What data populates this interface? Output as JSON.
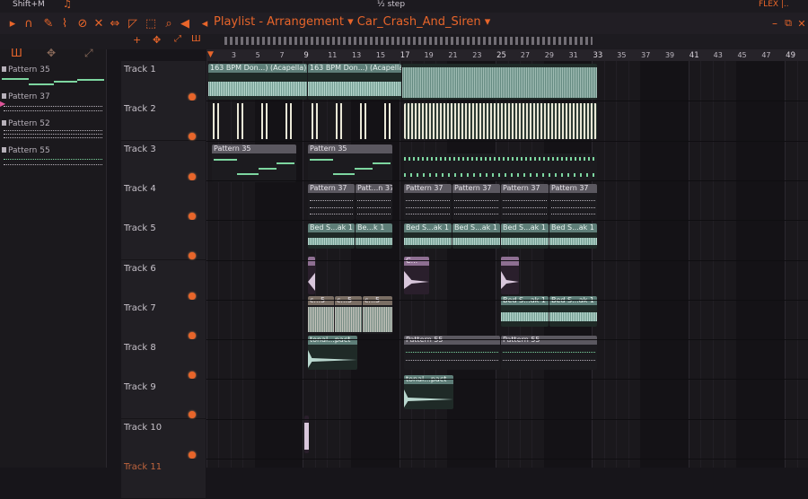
{
  "app": {
    "title": "Playlist - Arrangement",
    "project": "Car_Crash_And_Siren",
    "mode_label": "Shift+M",
    "flex_label": "FLEX |..",
    "step_label": "½ step"
  },
  "ruler": {
    "marks": [
      "3",
      "5",
      "7",
      "9",
      "11",
      "13",
      "15",
      "17",
      "19",
      "21",
      "23",
      "25",
      "27",
      "29",
      "31",
      "33",
      "35",
      "37",
      "39",
      "41",
      "43",
      "45",
      "47",
      "49"
    ],
    "major": [
      "9",
      "17",
      "25",
      "33",
      "41",
      "49"
    ]
  },
  "patterns": [
    {
      "name": "Pattern 35"
    },
    {
      "name": "Pattern 37"
    },
    {
      "name": "Pattern 52"
    },
    {
      "name": "Pattern 55"
    }
  ],
  "tracks": [
    "Track 1",
    "Track 2",
    "Track 3",
    "Track 4",
    "Track 5",
    "Track 6",
    "Track 7",
    "Track 8",
    "Track 9",
    "Track 10",
    "Track 11"
  ],
  "clips": {
    "t1a": "163 BPM Don...) (Acapella)",
    "t1b": "163 BPM Don...) (Acapella)",
    "t3a": "Pattern 35",
    "t3b": "Pattern 35",
    "t4a": "Pattern 37",
    "t4b": "Patt...n 37",
    "t4c": "Pattern 37",
    "t4d": "Pattern 37",
    "t4e": "Pattern 37",
    "t4f": "Pattern 37",
    "t5a": "Bed S...ak 1",
    "t5b": "Be...k 1",
    "t5c": "Bed S...ak 1",
    "t5d": "Bed S...ak 1",
    "t5e": "Bed S...ak 1",
    "t5f": "Bed S...ak 1",
    "t6b": "C...",
    "t7a": "c...5",
    "t7b": "c...5",
    "t7c": "c...5",
    "t7d": "Bed S...ak 1",
    "t7e": "Bed S...ak 1",
    "t8a": "tonal...pact",
    "t8b": "Pattern 55",
    "t8c": "Pattern 55",
    "t9a": "tonal...pact"
  },
  "colors": {
    "accent": "#e8652a",
    "audio_header": "#5e7e78",
    "pattern_header": "#5b5860",
    "purple_header": "#8e6f92",
    "note_green": "#7dd6a0"
  }
}
